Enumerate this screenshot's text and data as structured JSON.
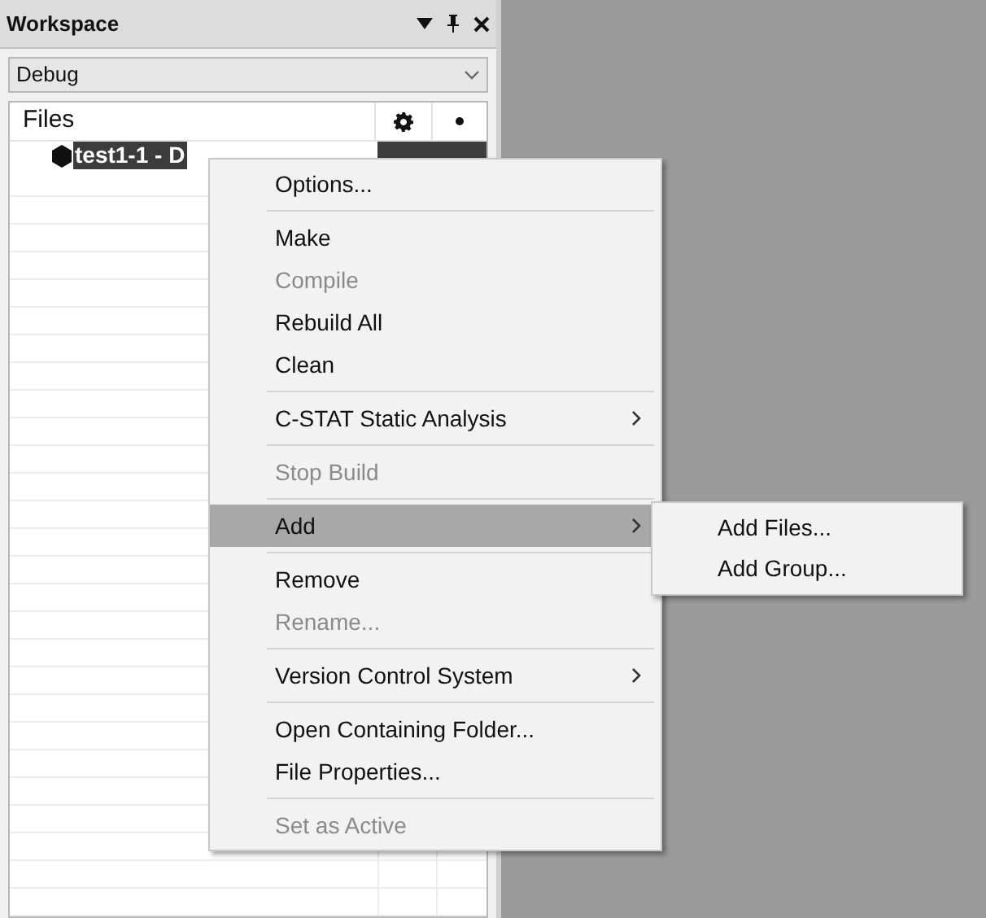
{
  "panel": {
    "title": "Workspace"
  },
  "configuration": {
    "value": "Debug"
  },
  "tree": {
    "header": "Files",
    "items": [
      {
        "label": "test1-1 - D",
        "selected": true
      }
    ]
  },
  "context_menu": [
    {
      "kind": "item",
      "label": "Options...",
      "disabled": false,
      "selected": false,
      "submenu": false
    },
    {
      "kind": "separator"
    },
    {
      "kind": "item",
      "label": "Make",
      "disabled": false,
      "selected": false,
      "submenu": false
    },
    {
      "kind": "item",
      "label": "Compile",
      "disabled": true,
      "selected": false,
      "submenu": false
    },
    {
      "kind": "item",
      "label": "Rebuild All",
      "disabled": false,
      "selected": false,
      "submenu": false
    },
    {
      "kind": "item",
      "label": "Clean",
      "disabled": false,
      "selected": false,
      "submenu": false
    },
    {
      "kind": "separator"
    },
    {
      "kind": "item",
      "label": "C-STAT Static Analysis",
      "disabled": false,
      "selected": false,
      "submenu": true
    },
    {
      "kind": "separator"
    },
    {
      "kind": "item",
      "label": "Stop Build",
      "disabled": true,
      "selected": false,
      "submenu": false
    },
    {
      "kind": "separator"
    },
    {
      "kind": "item",
      "label": "Add",
      "disabled": false,
      "selected": true,
      "submenu": true
    },
    {
      "kind": "separator"
    },
    {
      "kind": "item",
      "label": "Remove",
      "disabled": false,
      "selected": false,
      "submenu": false
    },
    {
      "kind": "item",
      "label": "Rename...",
      "disabled": true,
      "selected": false,
      "submenu": false
    },
    {
      "kind": "separator"
    },
    {
      "kind": "item",
      "label": "Version Control System",
      "disabled": false,
      "selected": false,
      "submenu": true
    },
    {
      "kind": "separator"
    },
    {
      "kind": "item",
      "label": "Open Containing Folder...",
      "disabled": false,
      "selected": false,
      "submenu": false
    },
    {
      "kind": "item",
      "label": "File Properties...",
      "disabled": false,
      "selected": false,
      "submenu": false
    },
    {
      "kind": "separator"
    },
    {
      "kind": "item",
      "label": "Set as Active",
      "disabled": true,
      "selected": false,
      "submenu": false
    }
  ],
  "submenu": [
    {
      "label": "Add Files..."
    },
    {
      "label": "Add Group..."
    }
  ]
}
